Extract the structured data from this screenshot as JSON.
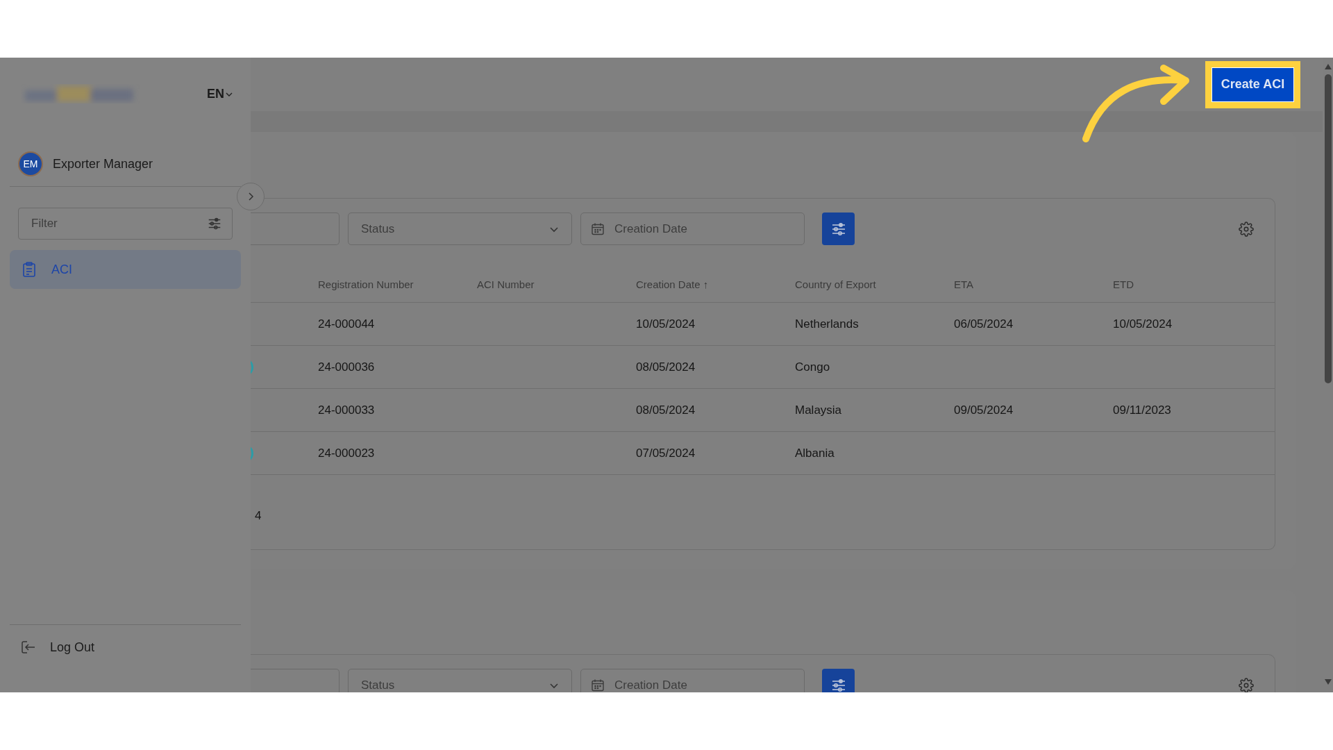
{
  "sidebar": {
    "language": "EN",
    "user": {
      "initials": "EM",
      "name": "Exporter Manager"
    },
    "filter": {
      "placeholder": "Filter"
    },
    "items": [
      {
        "label": "ACI",
        "selected": true
      }
    ],
    "logout": "Log Out"
  },
  "header": {
    "create_button": "Create ACI"
  },
  "cards": [
    {
      "filters": {
        "status_placeholder": "Status",
        "date_placeholder": "Creation Date"
      },
      "table": {
        "columns": [
          "Registration Number",
          "ACI Number",
          "Creation Date ↑",
          "Country of Export",
          "ETA",
          "ETD"
        ],
        "rows": [
          {
            "badge_visible": false,
            "cells": [
              "24-000044",
              "",
              "10/05/2024",
              "Netherlands",
              "06/05/2024",
              "10/05/2024"
            ]
          },
          {
            "badge_visible": true,
            "cells": [
              "24-000036",
              "",
              "08/05/2024",
              "Congo",
              "",
              ""
            ]
          },
          {
            "badge_visible": false,
            "cells": [
              "24-000033",
              "",
              "08/05/2024",
              "Malaysia",
              "09/05/2024",
              "09/11/2023"
            ]
          },
          {
            "badge_visible": true,
            "cells": [
              "24-000023",
              "",
              "07/05/2024",
              "Albania",
              "",
              ""
            ]
          }
        ]
      },
      "pagination": "4"
    },
    {
      "filters": {
        "status_placeholder": "Status",
        "date_placeholder": "Creation Date"
      }
    }
  ]
}
